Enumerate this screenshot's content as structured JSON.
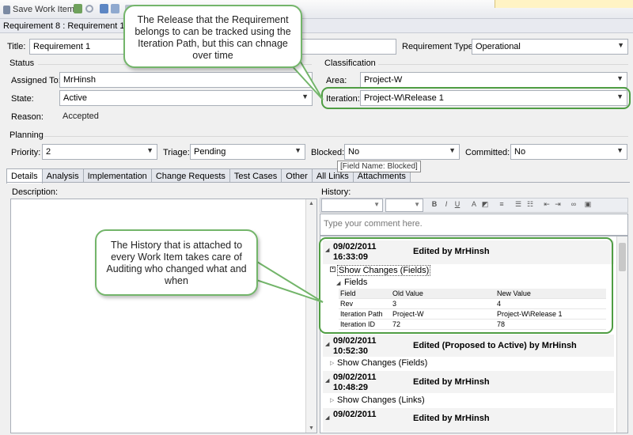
{
  "toolbar": {
    "save_label": "Save Work Item"
  },
  "window": {
    "title": "Requirement 8 : Requirement 1"
  },
  "form": {
    "title_label": "Title:",
    "title_value": "Requirement 1",
    "req_type_label": "Requirement Type:",
    "req_type_value": "Operational",
    "status_header": "Status",
    "assigned_label": "Assigned To:",
    "assigned_value": "MrHinsh",
    "state_label": "State:",
    "state_value": "Active",
    "reason_label": "Reason:",
    "reason_value": "Accepted",
    "classification_header": "Classification",
    "area_label": "Area:",
    "area_value": "Project-W",
    "iteration_label": "Iteration:",
    "iteration_value": "Project-W\\Release 1",
    "planning_header": "Planning",
    "priority_label": "Priority:",
    "priority_value": "2",
    "triage_label": "Triage:",
    "triage_value": "Pending",
    "blocked_label": "Blocked:",
    "blocked_value": "No",
    "committed_label": "Committed:",
    "committed_value": "No",
    "blocked_tooltip": "[Field Name: Blocked]"
  },
  "tabs": [
    "Details",
    "Analysis",
    "Implementation",
    "Change Requests",
    "Test Cases",
    "Other",
    "All Links",
    "Attachments"
  ],
  "details": {
    "description_label": "Description:",
    "history_label": "History:",
    "comment_placeholder": "Type your comment here."
  },
  "history": {
    "entries": [
      {
        "date": "09/02/2011",
        "time": "16:33:09",
        "by": "Edited by MrHinsh",
        "show": "Show Changes (Fields)"
      },
      {
        "date": "09/02/2011",
        "time": "10:52:30",
        "by": "Edited (Proposed to Active) by MrHinsh",
        "show": "Show Changes (Fields)"
      },
      {
        "date": "09/02/2011",
        "time": "10:48:29",
        "by": "Edited by MrHinsh",
        "show": "Show Changes (Links)"
      },
      {
        "date": "09/02/2011",
        "time": "",
        "by": "Edited by MrHinsh",
        "show": ""
      }
    ],
    "fields_label": "Fields",
    "table": {
      "headers": [
        "Field",
        "Old Value",
        "New Value"
      ],
      "rows": [
        [
          "Rev",
          "3",
          "4"
        ],
        [
          "Iteration Path",
          "Project-W",
          "Project-W\\Release 1"
        ],
        [
          "Iteration ID",
          "72",
          "78"
        ]
      ]
    }
  },
  "callouts": {
    "release": "The Release that the Requirement belongs to can be tracked using the Iteration Path, but this can chnage over time",
    "history": "The History that is attached to every Work Item takes care of Auditing who changed what and when"
  },
  "colors": {
    "callout_border": "#73b56a",
    "highlight": "#4f9d43"
  }
}
